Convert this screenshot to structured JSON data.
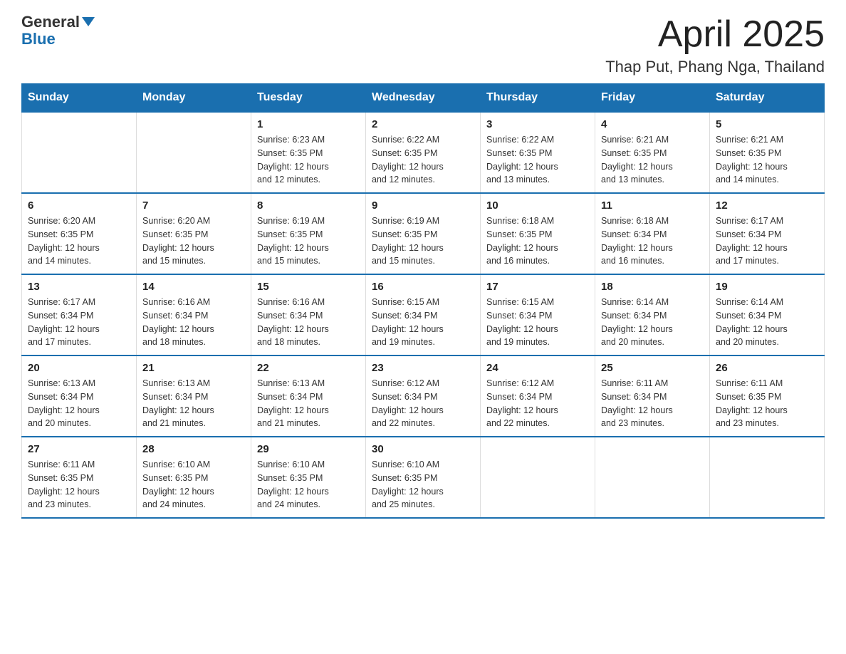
{
  "logo": {
    "general": "General",
    "arrow": "▼",
    "blue": "Blue"
  },
  "header": {
    "title": "April 2025",
    "subtitle": "Thap Put, Phang Nga, Thailand"
  },
  "weekdays": [
    "Sunday",
    "Monday",
    "Tuesday",
    "Wednesday",
    "Thursday",
    "Friday",
    "Saturday"
  ],
  "weeks": [
    [
      {
        "day": "",
        "info": ""
      },
      {
        "day": "",
        "info": ""
      },
      {
        "day": "1",
        "info": "Sunrise: 6:23 AM\nSunset: 6:35 PM\nDaylight: 12 hours\nand 12 minutes."
      },
      {
        "day": "2",
        "info": "Sunrise: 6:22 AM\nSunset: 6:35 PM\nDaylight: 12 hours\nand 12 minutes."
      },
      {
        "day": "3",
        "info": "Sunrise: 6:22 AM\nSunset: 6:35 PM\nDaylight: 12 hours\nand 13 minutes."
      },
      {
        "day": "4",
        "info": "Sunrise: 6:21 AM\nSunset: 6:35 PM\nDaylight: 12 hours\nand 13 minutes."
      },
      {
        "day": "5",
        "info": "Sunrise: 6:21 AM\nSunset: 6:35 PM\nDaylight: 12 hours\nand 14 minutes."
      }
    ],
    [
      {
        "day": "6",
        "info": "Sunrise: 6:20 AM\nSunset: 6:35 PM\nDaylight: 12 hours\nand 14 minutes."
      },
      {
        "day": "7",
        "info": "Sunrise: 6:20 AM\nSunset: 6:35 PM\nDaylight: 12 hours\nand 15 minutes."
      },
      {
        "day": "8",
        "info": "Sunrise: 6:19 AM\nSunset: 6:35 PM\nDaylight: 12 hours\nand 15 minutes."
      },
      {
        "day": "9",
        "info": "Sunrise: 6:19 AM\nSunset: 6:35 PM\nDaylight: 12 hours\nand 15 minutes."
      },
      {
        "day": "10",
        "info": "Sunrise: 6:18 AM\nSunset: 6:35 PM\nDaylight: 12 hours\nand 16 minutes."
      },
      {
        "day": "11",
        "info": "Sunrise: 6:18 AM\nSunset: 6:34 PM\nDaylight: 12 hours\nand 16 minutes."
      },
      {
        "day": "12",
        "info": "Sunrise: 6:17 AM\nSunset: 6:34 PM\nDaylight: 12 hours\nand 17 minutes."
      }
    ],
    [
      {
        "day": "13",
        "info": "Sunrise: 6:17 AM\nSunset: 6:34 PM\nDaylight: 12 hours\nand 17 minutes."
      },
      {
        "day": "14",
        "info": "Sunrise: 6:16 AM\nSunset: 6:34 PM\nDaylight: 12 hours\nand 18 minutes."
      },
      {
        "day": "15",
        "info": "Sunrise: 6:16 AM\nSunset: 6:34 PM\nDaylight: 12 hours\nand 18 minutes."
      },
      {
        "day": "16",
        "info": "Sunrise: 6:15 AM\nSunset: 6:34 PM\nDaylight: 12 hours\nand 19 minutes."
      },
      {
        "day": "17",
        "info": "Sunrise: 6:15 AM\nSunset: 6:34 PM\nDaylight: 12 hours\nand 19 minutes."
      },
      {
        "day": "18",
        "info": "Sunrise: 6:14 AM\nSunset: 6:34 PM\nDaylight: 12 hours\nand 20 minutes."
      },
      {
        "day": "19",
        "info": "Sunrise: 6:14 AM\nSunset: 6:34 PM\nDaylight: 12 hours\nand 20 minutes."
      }
    ],
    [
      {
        "day": "20",
        "info": "Sunrise: 6:13 AM\nSunset: 6:34 PM\nDaylight: 12 hours\nand 20 minutes."
      },
      {
        "day": "21",
        "info": "Sunrise: 6:13 AM\nSunset: 6:34 PM\nDaylight: 12 hours\nand 21 minutes."
      },
      {
        "day": "22",
        "info": "Sunrise: 6:13 AM\nSunset: 6:34 PM\nDaylight: 12 hours\nand 21 minutes."
      },
      {
        "day": "23",
        "info": "Sunrise: 6:12 AM\nSunset: 6:34 PM\nDaylight: 12 hours\nand 22 minutes."
      },
      {
        "day": "24",
        "info": "Sunrise: 6:12 AM\nSunset: 6:34 PM\nDaylight: 12 hours\nand 22 minutes."
      },
      {
        "day": "25",
        "info": "Sunrise: 6:11 AM\nSunset: 6:34 PM\nDaylight: 12 hours\nand 23 minutes."
      },
      {
        "day": "26",
        "info": "Sunrise: 6:11 AM\nSunset: 6:35 PM\nDaylight: 12 hours\nand 23 minutes."
      }
    ],
    [
      {
        "day": "27",
        "info": "Sunrise: 6:11 AM\nSunset: 6:35 PM\nDaylight: 12 hours\nand 23 minutes."
      },
      {
        "day": "28",
        "info": "Sunrise: 6:10 AM\nSunset: 6:35 PM\nDaylight: 12 hours\nand 24 minutes."
      },
      {
        "day": "29",
        "info": "Sunrise: 6:10 AM\nSunset: 6:35 PM\nDaylight: 12 hours\nand 24 minutes."
      },
      {
        "day": "30",
        "info": "Sunrise: 6:10 AM\nSunset: 6:35 PM\nDaylight: 12 hours\nand 25 minutes."
      },
      {
        "day": "",
        "info": ""
      },
      {
        "day": "",
        "info": ""
      },
      {
        "day": "",
        "info": ""
      }
    ]
  ]
}
